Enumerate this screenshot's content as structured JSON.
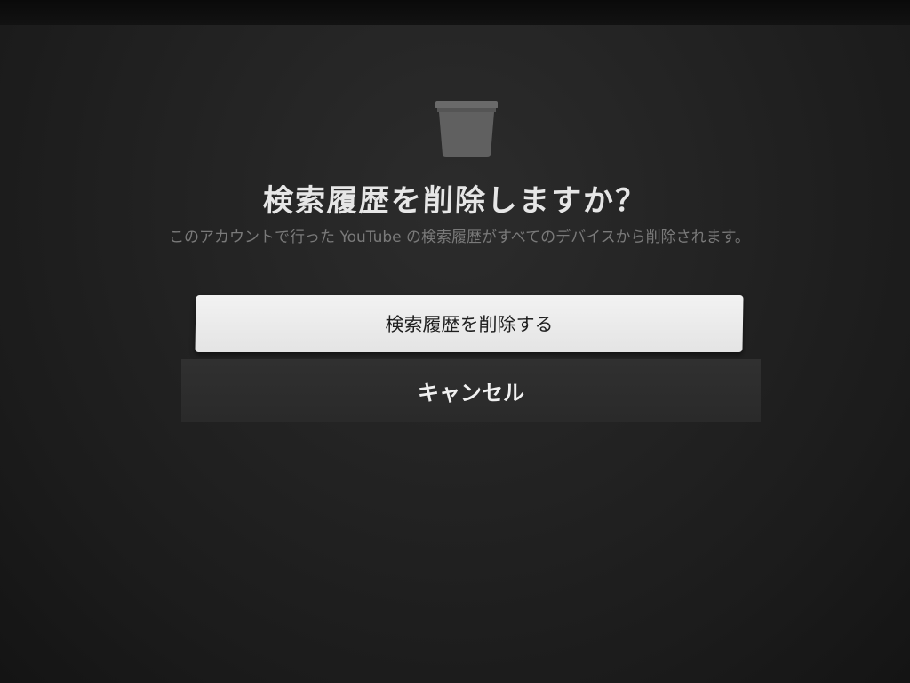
{
  "dialog": {
    "icon": "trash-icon",
    "title": "検索履歴を削除しますか？",
    "message": "このアカウントで行った YouTube の検索履歴がすべてのデバイスから削除されます。",
    "confirm_label": "検索履歴を削除する",
    "cancel_label": "キャンセル"
  },
  "colors": {
    "background": "#232323",
    "confirm_button_bg": "#ececec",
    "cancel_button_bg": "#2d2d2d",
    "title_text": "#e6e6e6",
    "message_text": "#7a7a7a"
  }
}
